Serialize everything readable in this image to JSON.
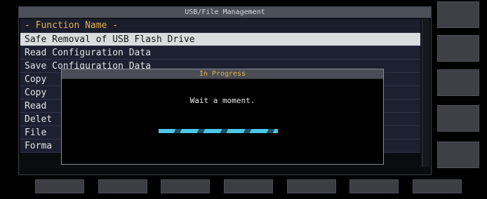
{
  "window": {
    "title": "USB/File Management"
  },
  "list": {
    "header": "- Function Name -",
    "items": [
      "Safe Removal of USB Flash Drive",
      "Read Configuration Data",
      "Save Configuration Data",
      "Copy",
      "Copy",
      "Read",
      "Delet",
      "File",
      "Forma"
    ],
    "selected_index": 0
  },
  "dialog": {
    "title": "In Progress",
    "message": "Wait a moment.",
    "progress": "indeterminate"
  },
  "colors": {
    "header_text": "#e8b34a",
    "selected_row": "#dadcdf",
    "progress": "#4bc6e6"
  }
}
